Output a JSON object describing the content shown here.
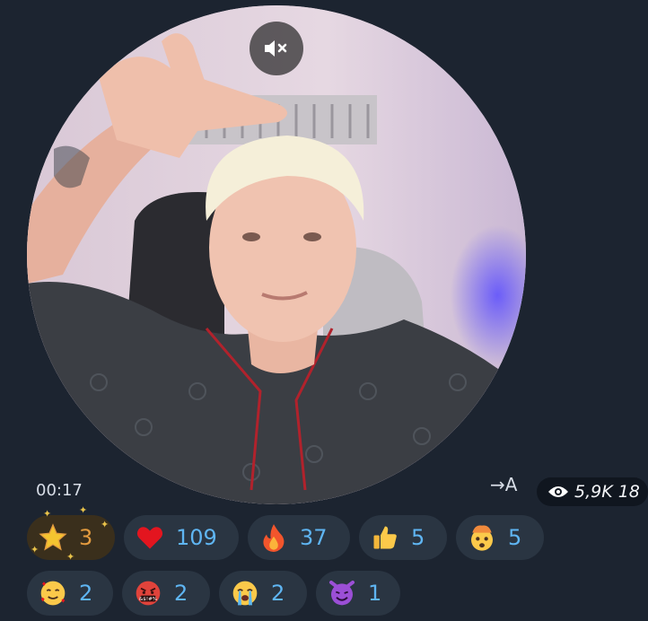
{
  "video": {
    "duration": "00:17",
    "translate_label": "→A",
    "mute_icon": "speaker-muted-icon"
  },
  "views": {
    "count": "5,9K 18"
  },
  "reactions": [
    {
      "emoji": "star",
      "count": "3"
    },
    {
      "emoji": "heart",
      "count": "109"
    },
    {
      "emoji": "fire",
      "count": "37"
    },
    {
      "emoji": "thumbs-up",
      "count": "5"
    },
    {
      "emoji": "exploding-head",
      "count": "5"
    },
    {
      "emoji": "smiling-face-with-hearts",
      "count": "2"
    },
    {
      "emoji": "face-with-symbols",
      "count": "2"
    },
    {
      "emoji": "loudly-crying-face",
      "count": "2"
    },
    {
      "emoji": "smiling-devil",
      "count": "1"
    }
  ],
  "colors": {
    "background": "#1c2430",
    "pill": "#2a3542",
    "count_text": "#5fb5f2",
    "star_count": "#e39b3f"
  }
}
